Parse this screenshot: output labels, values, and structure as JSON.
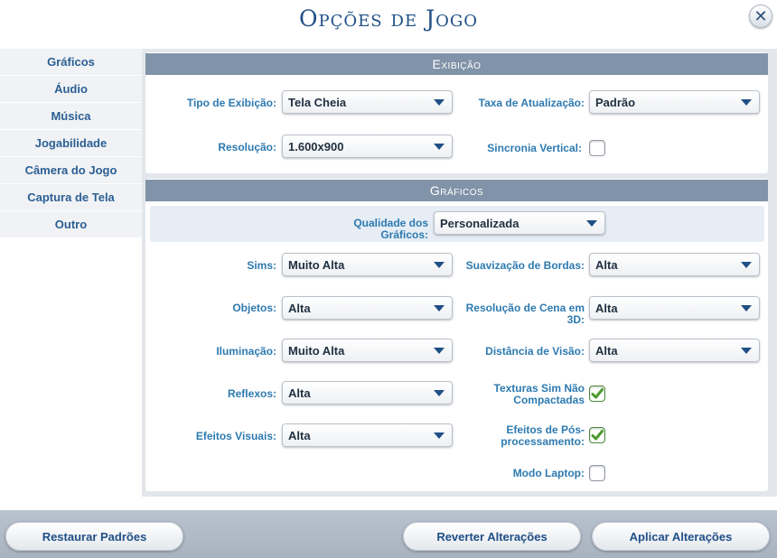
{
  "title": "Opções de Jogo",
  "close_symbol": "✕",
  "sidebar": {
    "items": [
      {
        "label": "Gráficos"
      },
      {
        "label": "Áudio"
      },
      {
        "label": "Música"
      },
      {
        "label": "Jogabilidade"
      },
      {
        "label": "Câmera do Jogo"
      },
      {
        "label": "Captura de Tela"
      },
      {
        "label": "Outro"
      }
    ]
  },
  "display": {
    "header": "Exibição",
    "display_type": {
      "label": "Tipo de Exibição:",
      "value": "Tela Cheia"
    },
    "refresh_rate": {
      "label": "Taxa de Atualização:",
      "value": "Padrão"
    },
    "resolution": {
      "label": "Resolução:",
      "value": "1.600x900"
    },
    "vsync": {
      "label": "Sincronia Vertical:",
      "checked": false
    }
  },
  "graphics": {
    "header": "Gráficos",
    "quality": {
      "label_line1": "Qualidade dos",
      "label_line2": "Gráficos:",
      "value": "Personalizada"
    },
    "sims": {
      "label": "Sims:",
      "value": "Muito Alta"
    },
    "edge_smoothing": {
      "label": "Suavização de Bordas:",
      "value": "Alta"
    },
    "objects": {
      "label": "Objetos:",
      "value": "Alta"
    },
    "scene_resolution": {
      "label_line1": "Resolução de Cena em",
      "label_line2": "3D:",
      "value": "Alta"
    },
    "lighting": {
      "label": "Iluminação:",
      "value": "Muito Alta"
    },
    "view_distance": {
      "label": "Distância de Visão:",
      "value": "Alta"
    },
    "reflections": {
      "label": "Reflexos:",
      "value": "Alta"
    },
    "uncompressed_textures": {
      "label_line1": "Texturas Sim Não",
      "label_line2": "Compactadas",
      "checked": true
    },
    "visual_effects": {
      "label": "Efeitos Visuais:",
      "value": "Alta"
    },
    "post_processing": {
      "label_line1": "Efeitos de Pós-",
      "label_line2": "processamento:",
      "checked": true
    },
    "laptop_mode": {
      "label": "Modo Laptop:",
      "checked": false
    }
  },
  "footer": {
    "restore_defaults": "Restaurar Padrões",
    "revert_changes": "Reverter Alterações",
    "apply_changes": "Aplicar Alterações"
  },
  "colors": {
    "title": "#1f4f86",
    "label": "#2d7ab0",
    "section_header": "#8193a8",
    "check_green": "#4b9a2e"
  }
}
